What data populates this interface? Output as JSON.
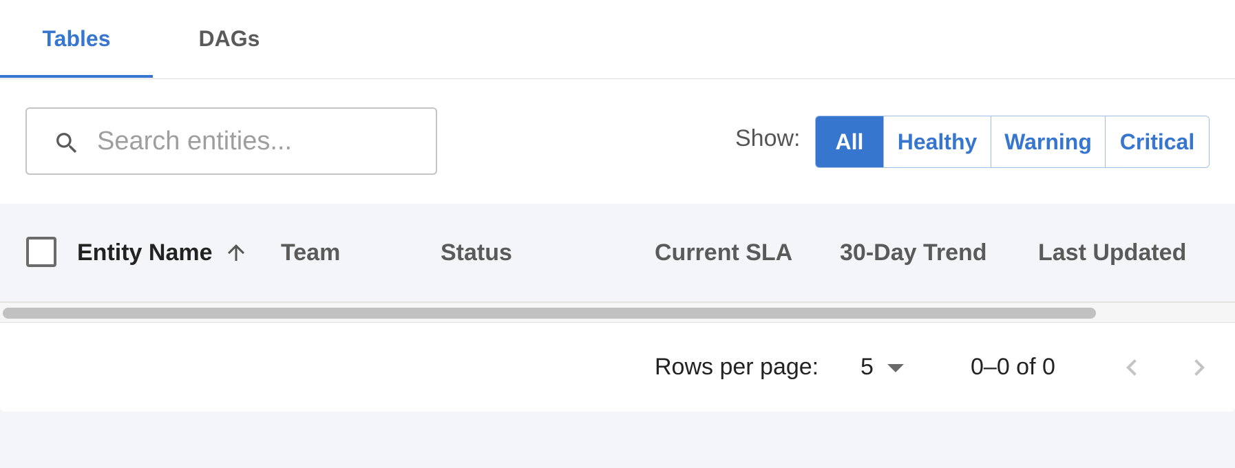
{
  "tabs": [
    {
      "label": "Tables",
      "active": true
    },
    {
      "label": "DAGs",
      "active": false
    }
  ],
  "search": {
    "placeholder": "Search entities...",
    "value": "",
    "icon": "search-icon"
  },
  "filter": {
    "label": "Show:",
    "options": [
      {
        "label": "All",
        "active": true
      },
      {
        "label": "Healthy",
        "active": false
      },
      {
        "label": "Warning",
        "active": false
      },
      {
        "label": "Critical",
        "active": false
      }
    ]
  },
  "table": {
    "columns": {
      "entity_name": "Entity Name",
      "team": "Team",
      "status": "Status",
      "current_sla": "Current SLA",
      "trend": "30-Day Trend",
      "last_updated": "Last Updated"
    },
    "sort": {
      "column": "Entity Name",
      "direction": "ascending",
      "icon": "arrow-up-icon"
    },
    "rows": []
  },
  "pagination": {
    "rows_per_page_label": "Rows per page:",
    "rows_per_page": "5",
    "range": "0–0 of 0"
  },
  "colors": {
    "accent": "#3776cf",
    "background": "#f4f5f8",
    "card": "#ffffff"
  }
}
